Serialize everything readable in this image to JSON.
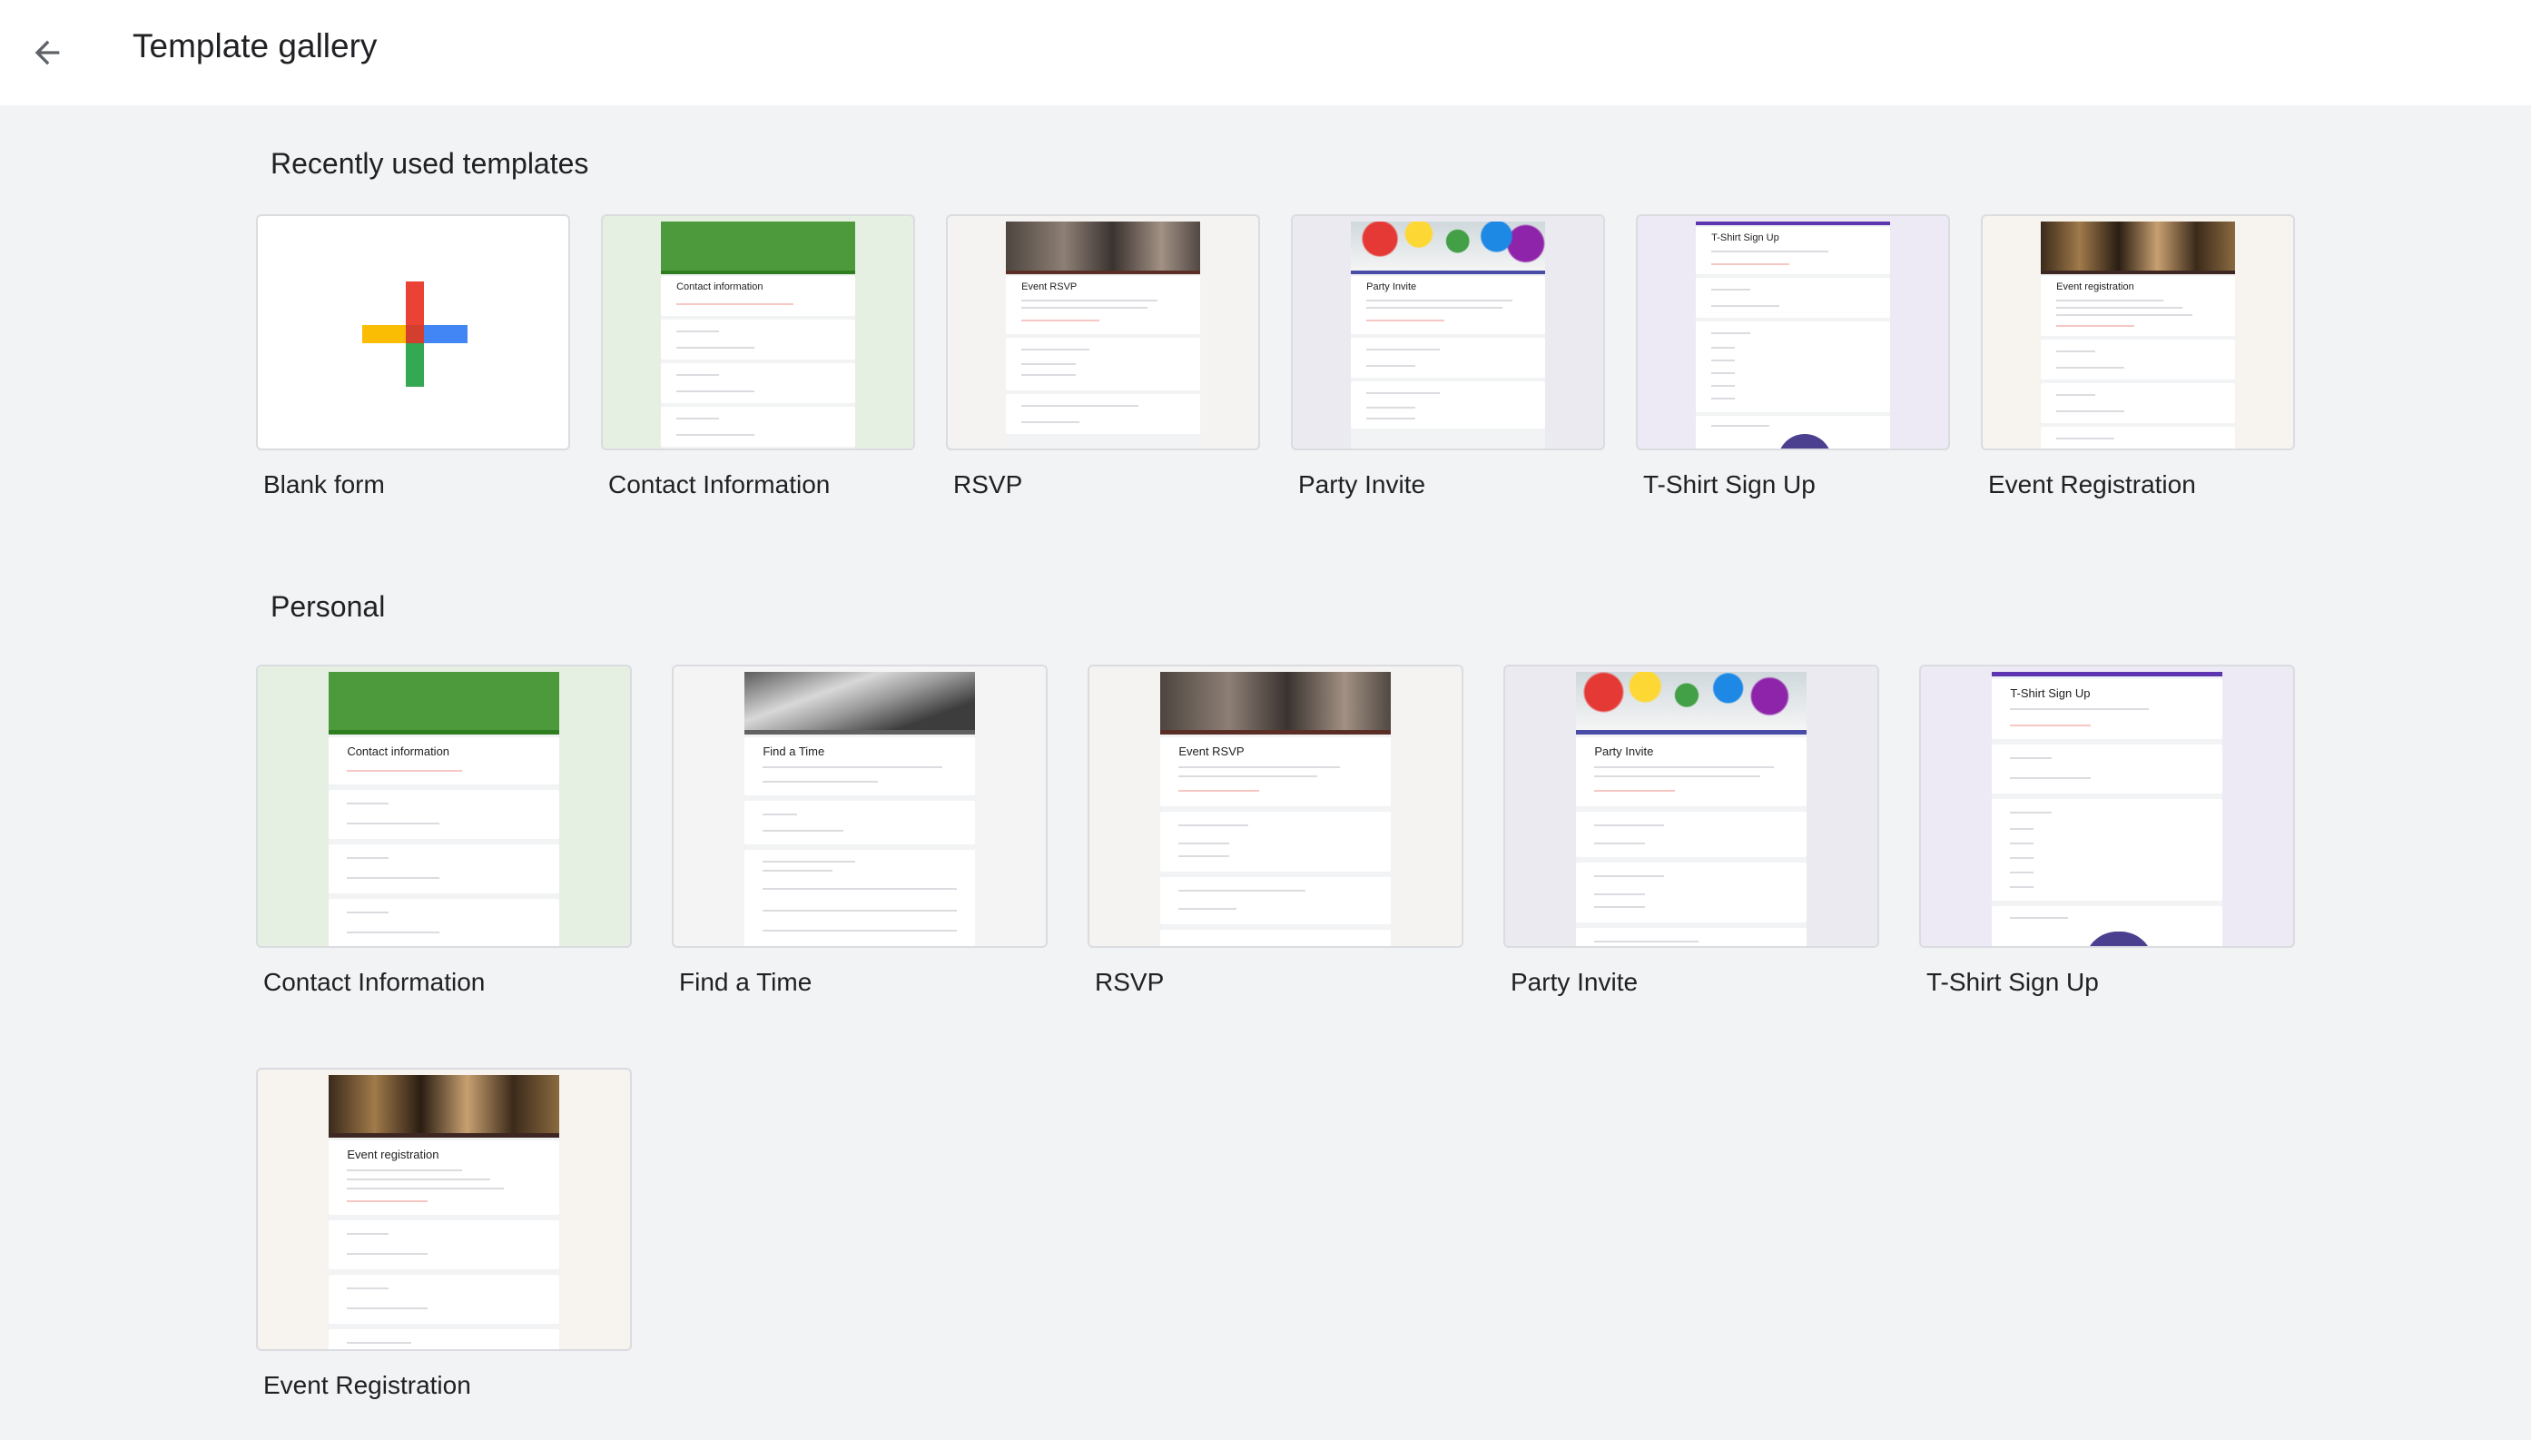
{
  "header": {
    "back_icon": "arrow-left-icon",
    "title": "Template gallery"
  },
  "sections": {
    "recent": {
      "title": "Recently used templates",
      "items": [
        {
          "label": "Blank form"
        },
        {
          "label": "Contact Information",
          "thumb_title": "Contact information"
        },
        {
          "label": "RSVP",
          "thumb_title": "Event RSVP"
        },
        {
          "label": "Party Invite",
          "thumb_title": "Party Invite"
        },
        {
          "label": "T-Shirt Sign Up",
          "thumb_title": "T-Shirt Sign Up"
        },
        {
          "label": "Event Registration",
          "thumb_title": "Event registration"
        }
      ]
    },
    "personal": {
      "title": "Personal",
      "items": [
        {
          "label": "Contact Information",
          "thumb_title": "Contact information"
        },
        {
          "label": "Find a Time",
          "thumb_title": "Find a Time"
        },
        {
          "label": "RSVP",
          "thumb_title": "Event RSVP"
        },
        {
          "label": "Party Invite",
          "thumb_title": "Party Invite"
        },
        {
          "label": "T-Shirt Sign Up",
          "thumb_title": "T-Shirt Sign Up"
        },
        {
          "label": "Event Registration",
          "thumb_title": "Event registration"
        }
      ]
    }
  },
  "colors": {
    "contact_bg": "#e6f0e2",
    "contact_accent": "#3f8f2f",
    "rsvp_bg": "#f5f3f1",
    "rsvp_accent": "#5a2e25",
    "party_bg": "#eceaf1",
    "party_accent": "#4a4da8",
    "tshirt_bg": "#ede9f5",
    "tshirt_accent": "#5e35b1",
    "event_bg": "#f7f3ee",
    "event_accent": "#3e2723",
    "findtime_bg": "#f4f4f4",
    "findtime_accent": "#616161"
  }
}
